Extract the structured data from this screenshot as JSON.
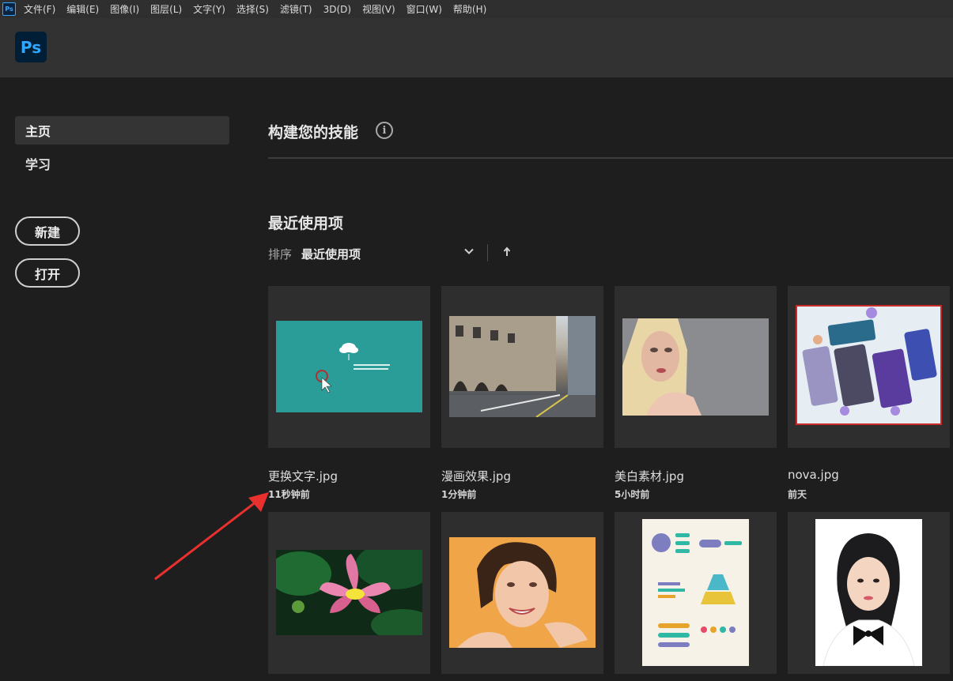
{
  "menubar": {
    "app_icon": "Ps",
    "items": [
      "文件(F)",
      "编辑(E)",
      "图像(I)",
      "图层(L)",
      "文字(Y)",
      "选择(S)",
      "滤镜(T)",
      "3D(D)",
      "视图(V)",
      "窗口(W)",
      "帮助(H)"
    ]
  },
  "topbar": {
    "logo": "Ps"
  },
  "sidebar": {
    "nav": [
      "主页",
      "学习"
    ],
    "buttons": {
      "new": "新建",
      "open": "打开"
    }
  },
  "main": {
    "skills_title": "构建您的技能",
    "info_icon": "i",
    "recent_title": "最近使用项",
    "sort_label": "排序",
    "sort_value": "最近使用项"
  },
  "files": [
    {
      "name": "更换文字.jpg",
      "time": "11秒钟前"
    },
    {
      "name": "漫画效果.jpg",
      "time": "1分钟前"
    },
    {
      "name": "美白素材.jpg",
      "time": "5小时前"
    },
    {
      "name": "nova.jpg",
      "time": "前天"
    }
  ],
  "colors": {
    "accent_blue": "#31a8ff",
    "annotation_red": "#e8302e",
    "teal_thumb": "#2a9d98"
  },
  "icons": [
    "info-icon",
    "chevron-down-icon",
    "arrow-up-icon",
    "cloud-icon",
    "cursor-icon"
  ]
}
